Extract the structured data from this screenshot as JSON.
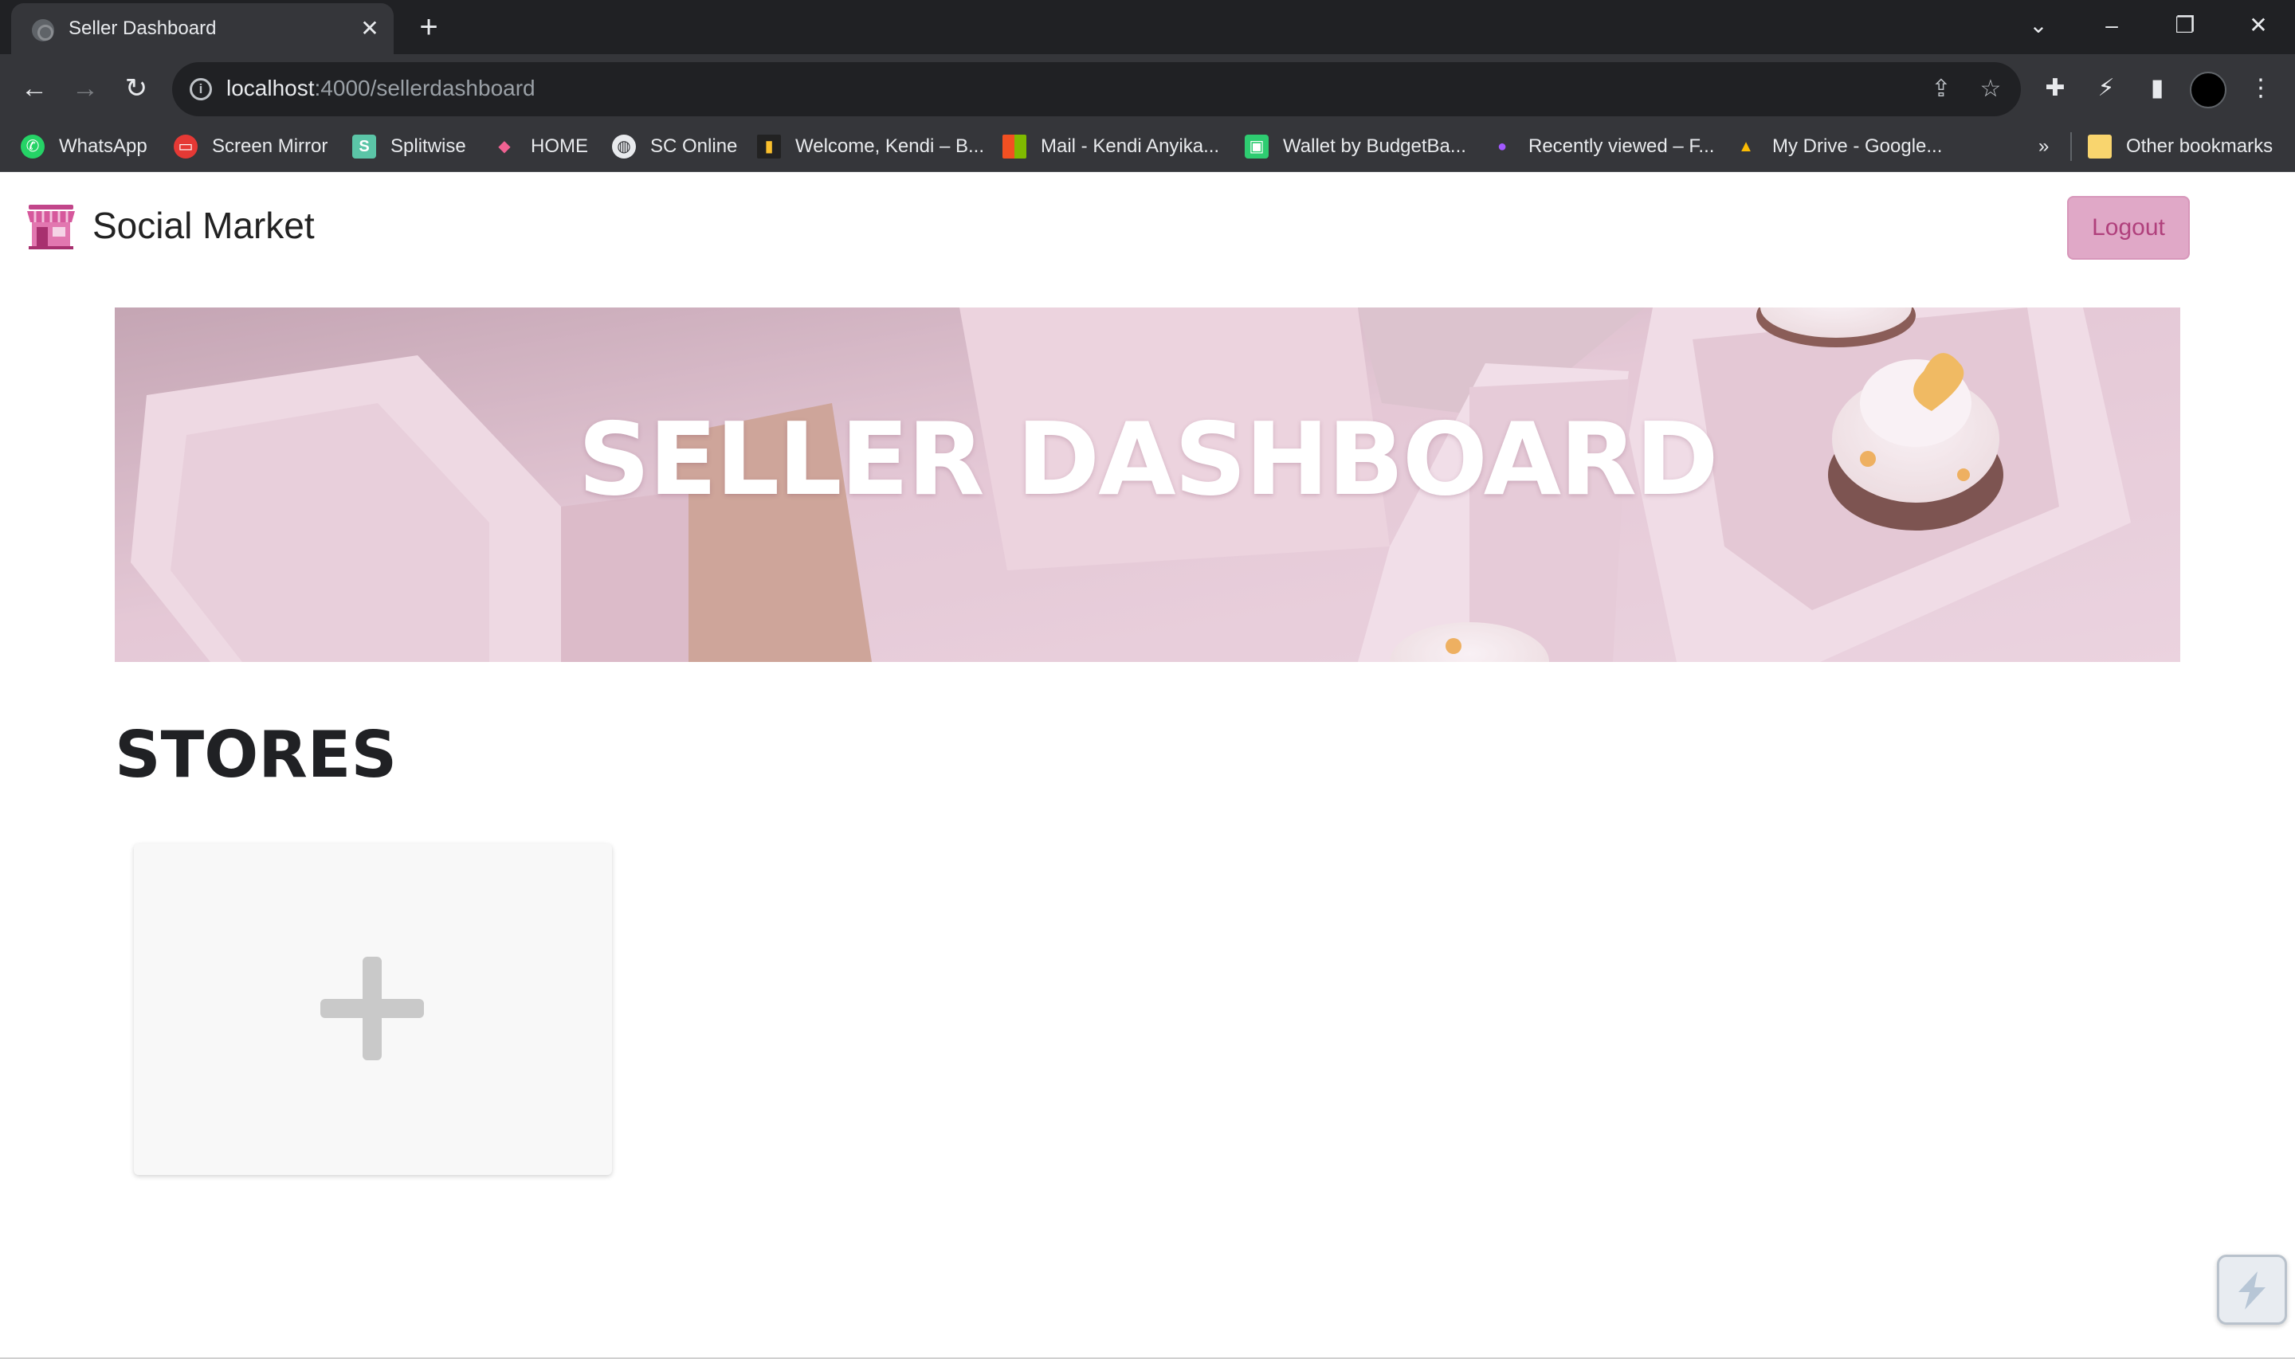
{
  "browser": {
    "tab_title": "Seller Dashboard",
    "url_host": "localhost",
    "url_path": ":4000/sellerdashboard",
    "bookmarks": [
      {
        "label": "WhatsApp",
        "icon": "whatsapp-icon",
        "color": "#25d366"
      },
      {
        "label": "Screen Mirror",
        "icon": "screen-mirror-icon",
        "color": "#e53935"
      },
      {
        "label": "Splitwise",
        "icon": "splitwise-icon",
        "color": "#5bc5a7"
      },
      {
        "label": "HOME",
        "icon": "home-icon",
        "color": "#c2185b"
      },
      {
        "label": "SC Online",
        "icon": "globe-icon",
        "color": "#9e9e9e"
      },
      {
        "label": "Welcome, Kendi – B...",
        "icon": "bar-chart-icon",
        "color": "#fbc02d"
      },
      {
        "label": "Mail - Kendi Anyika...",
        "icon": "microsoft-icon",
        "color": "#f25022"
      },
      {
        "label": "Wallet by BudgetBa...",
        "icon": "wallet-icon",
        "color": "#2ecc71"
      },
      {
        "label": "Recently viewed – F...",
        "icon": "figma-icon",
        "color": "#a259ff"
      },
      {
        "label": "My Drive - Google...",
        "icon": "google-drive-icon",
        "color": "#fbbc04"
      }
    ],
    "overflow_label": "»",
    "other_bookmarks": "Other bookmarks"
  },
  "header": {
    "brand_name": "Social Market",
    "logout_label": "Logout"
  },
  "hero": {
    "title": "SELLER DASHBOARD"
  },
  "stores": {
    "section_title": "STORES"
  },
  "colors": {
    "accent": "#e0a8c7",
    "accent_text": "#b0407c",
    "hero_tint": "#e7cfdb"
  }
}
